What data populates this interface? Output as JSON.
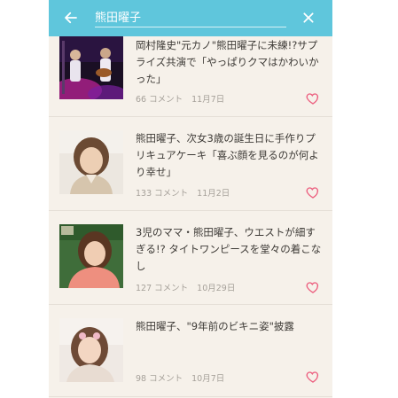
{
  "header": {
    "search_value": "熊田曜子",
    "back_icon": "arrow-left-icon",
    "clear_icon": "close-icon"
  },
  "colors": {
    "appbar": "#5fc6dc",
    "background": "#f6f1ea",
    "heart": "#ec5f7f"
  },
  "articles": [
    {
      "title": "岡村隆史\"元カノ\"熊田曜子に未練!?サプライズ共演で「やっぱりクマはかわいかった」",
      "comments": "66 コメント",
      "date": "11月7日"
    },
    {
      "title": "熊田曜子、次女3歳の誕生日に手作りプリキュアケーキ「喜ぶ顔を見るのが何より幸せ」",
      "comments": "133 コメント",
      "date": "11月2日"
    },
    {
      "title": "3児のママ・熊田曜子、ウエストが細すぎる!? タイトワンピースを堂々の着こなし",
      "comments": "127 コメント",
      "date": "10月29日"
    },
    {
      "title": "熊田曜子、\"9年前のビキニ姿\"披露",
      "comments": "98 コメント",
      "date": "10月7日"
    }
  ]
}
